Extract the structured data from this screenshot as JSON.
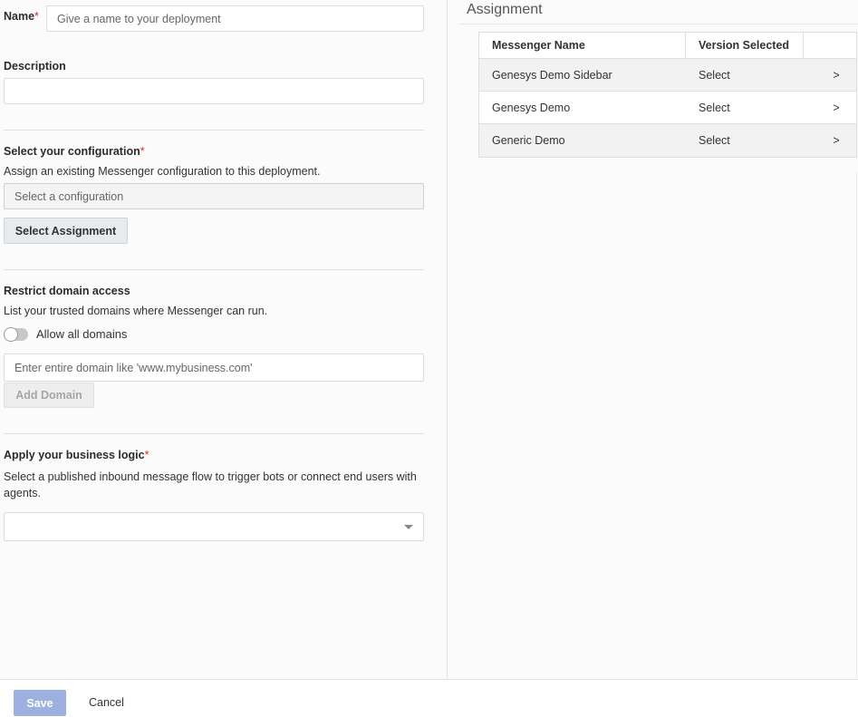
{
  "form": {
    "name_label": "Name",
    "required_mark": "*",
    "name_placeholder": "Give a name to your deployment",
    "description_label": "Description",
    "description_value": "",
    "configuration_label": "Select your configuration",
    "configuration_help": "Assign an existing Messenger configuration to this deployment.",
    "configuration_placeholder": "Select a configuration",
    "select_assignment_button": "Select Assignment",
    "domain_label": "Restrict domain access",
    "domain_help": "List your trusted domains where Messenger can run.",
    "allow_all_domains_label": "Allow all domains",
    "allow_all_domains_enabled": false,
    "domain_placeholder": "Enter entire domain like 'www.mybusiness.com'",
    "add_domain_button": "Add Domain",
    "business_logic_label": "Apply your business logic",
    "business_logic_help": "Select a published inbound message flow to trigger bots or connect end users with agents.",
    "business_logic_value": ""
  },
  "assignment": {
    "title": "Assignment",
    "columns": [
      "Messenger Name",
      "Version Selected",
      ""
    ],
    "rows": [
      {
        "name": "Genesys Demo Sidebar",
        "version": "Select",
        "action": ">"
      },
      {
        "name": "Genesys Demo",
        "version": "Select",
        "action": ">"
      },
      {
        "name": "Generic Demo",
        "version": "Select",
        "action": ">"
      }
    ]
  },
  "footer": {
    "save_label": "Save",
    "cancel_label": "Cancel"
  },
  "colors": {
    "required": "#d9292a",
    "save_button": "#9cb1df"
  }
}
